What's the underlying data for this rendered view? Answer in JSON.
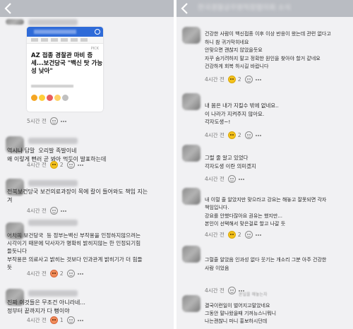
{
  "left": {
    "header": {
      "title": ""
    },
    "article_card": {
      "pick_label": "PICK",
      "title": "AZ 접종 경찰관 마비 증\n세...보건당국 \"백신 탓 가능\n성 낮아\""
    },
    "comments": [
      {
        "text": "",
        "time": "",
        "reaction_count": ""
      },
      {
        "text": "",
        "time": "5시간 전",
        "reaction_count": ""
      },
      {
        "text": "역시나 답말  오리발 족발이네\n왜 이렇게 뻔러 곧 봐아 먹듯이 발표하는데",
        "time": "4시간 전",
        "reaction_count": "2"
      },
      {
        "text": "전북보건당국 보건의료과장이 목에 칼이 들어와도 책임 지는\n겨",
        "time": "4시간 전",
        "reaction_count": ""
      },
      {
        "text": "어차피 보건당국  등 정부는백신 부작용을 인정하지않으려는\n시각이기 때문에 닥사자가 명확히 밝히지않는 한 인정되기힘\n들듯니다\n부작용은 의료사고 밝히는 것보다 인과관계 밝히기가 더 힘들\n듯",
        "time": "4시간 전",
        "reaction_count": "2"
      },
      {
        "text": "진짜 이것들은 무조건 아니라네...\n정부터 끝까지가 다 뻥이야",
        "time": "4시간 전",
        "reaction_count": "1"
      }
    ]
  },
  "right": {
    "header": {
      "title": "한국경찰공무원직장협의회 소식"
    },
    "comments": [
      {
        "text": "건강한 사람이 백신접종 이후 이상 반응이 왔는데 관련 없다고\n하니 참 귀가막히네요\n안맞으면 괜찮지 않았을듯요\n자꾸 숨기려하지 말고 정확한 원인을 찾아야 할거 같네요\n건강하게 회복 하시길 바랍니다",
        "time": "4시간 전",
        "reaction_count": "2"
      },
      {
        "text": "내 몸은 내가 지킬수 밖에 없네요..\n이 나라가 지켜주지 않아요.\n각자도생~!",
        "time": "4시간 전",
        "reaction_count": "2"
      },
      {
        "text": "그럴 줄 알고 있었다\n각자도생 이란 의미겠지",
        "time": "4시간 전",
        "reaction_count": ""
      },
      {
        "text": "내 이럴 줄 알았지만 맞으라고 강요는 해놓고 잘못되면 각자\n책임입니다.\n강요를 안했다잖아요 권유는 했지만...\n본인이 선택해서 맞은걸로 할고 나갈 듯",
        "time": "4시간 전",
        "reaction_count": "2"
      },
      {
        "text": "그럴줄 알았음 인과성 없다 웃기는 개소리 그분 아주 건강한\n사람 이었음",
        "time": "4시간 전",
        "reaction_count": ""
      },
      {
        "text": "결국이런일이 벌어지고말았네요\n그동안 말나왔을때 기꺼뉴스니뭐니\n나는괜찮니 마니 홍보하시던데",
        "time": "",
        "reaction_count": ""
      }
    ],
    "notice_label": "본일을 해놓는자"
  },
  "icons": {
    "back": "chevron-left-icon",
    "emoji": "emoji-reaction-icon",
    "more": "more-dots-icon"
  },
  "colors": {
    "header": "#b9bcc2",
    "background": "#f1f1f3",
    "card_accent": "#2f6bd8"
  }
}
